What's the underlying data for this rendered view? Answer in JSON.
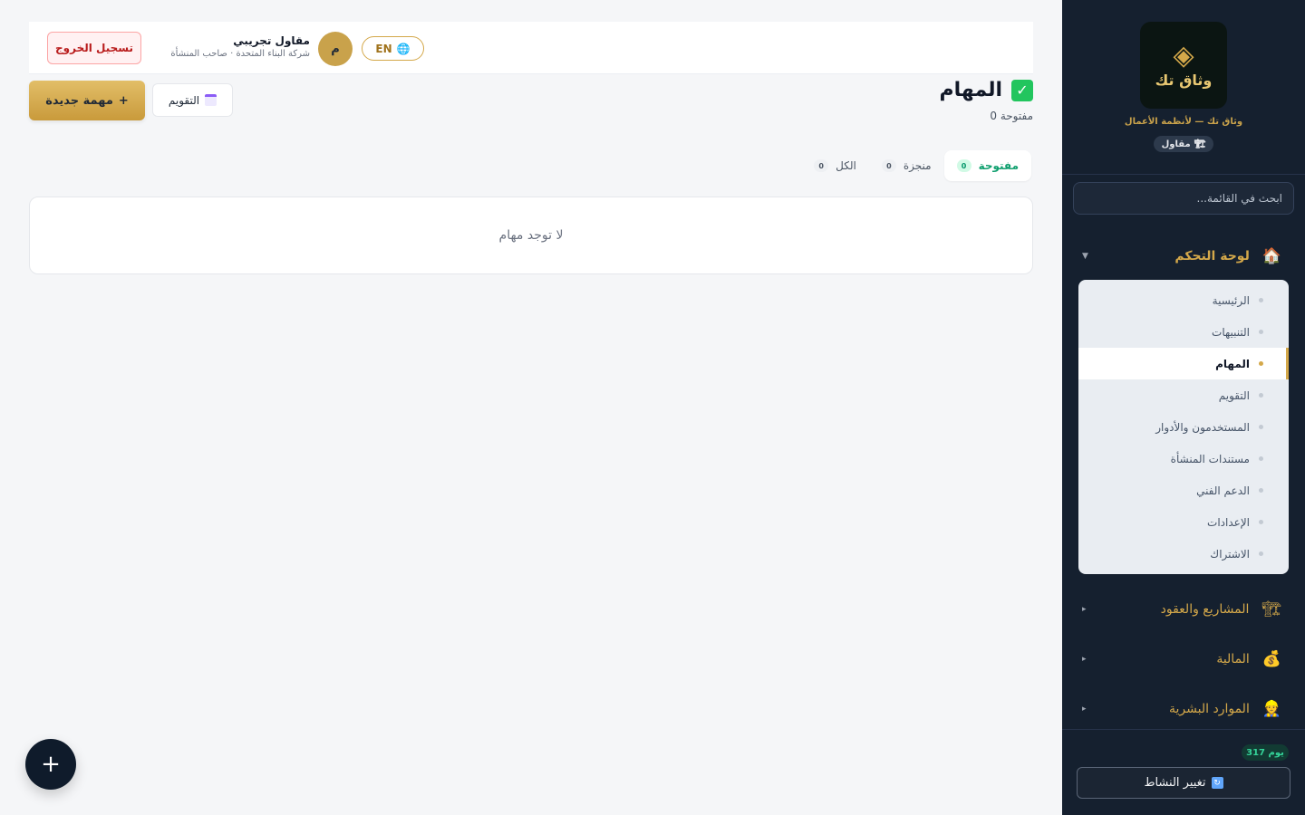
{
  "sidebar": {
    "logo_text": "وثاق تك",
    "brand_tagline": "وثاق تك — لأنظمة الأعمال",
    "role_badge": {
      "icon": "crane-icon",
      "label": "مقاول"
    },
    "search_placeholder": "ابحث في القائمة...",
    "groups": [
      {
        "icon": "house-icon",
        "label": "لوحة التحكم",
        "expanded": true
      },
      {
        "icon": "construction-icon",
        "label": "المشاريع والعقود",
        "expanded": false
      },
      {
        "icon": "money-bag-icon",
        "label": "المالية",
        "expanded": false
      },
      {
        "icon": "person-icon",
        "label": "الموارد البشرية",
        "expanded": false
      }
    ],
    "dashboard_items": [
      {
        "label": "الرئيسية",
        "active": false
      },
      {
        "label": "التنبيهات",
        "active": false
      },
      {
        "label": "المهام",
        "active": true
      },
      {
        "label": "التقويم",
        "active": false
      },
      {
        "label": "المستخدمون والأدوار",
        "active": false
      },
      {
        "label": "مستندات المنشأة",
        "active": false
      },
      {
        "label": "الدعم الفني",
        "active": false
      },
      {
        "label": "الإعدادات",
        "active": false
      },
      {
        "label": "الاشتراك",
        "active": false
      }
    ],
    "days_remaining": "317 يوم",
    "switch_activity_label": "تغيير النشاط"
  },
  "topbar": {
    "logout_label": "تسجيل الخروج",
    "user_name": "مقاول تجريبي",
    "user_subtitle": "شركة البناء المتحدة · صاحب المنشأة",
    "avatar_initial": "م",
    "language_label": "EN"
  },
  "page": {
    "title": "المهام",
    "open_count_text": "0 مفتوحة",
    "new_task_label": "مهمة جديدة",
    "calendar_label": "التقويم"
  },
  "tabs": [
    {
      "label": "مفتوحة",
      "count": "0",
      "active": true
    },
    {
      "label": "منجزة",
      "count": "0",
      "active": false
    },
    {
      "label": "الكل",
      "count": "0",
      "active": false
    }
  ],
  "empty_message": "لا توجد مهام",
  "fab_label": "+",
  "colors": {
    "sidebar_bg": "#15202f",
    "accent_gold": "#d4a84a",
    "active_tab_green": "#0f9f6e",
    "logout_red": "#b91c1c"
  }
}
